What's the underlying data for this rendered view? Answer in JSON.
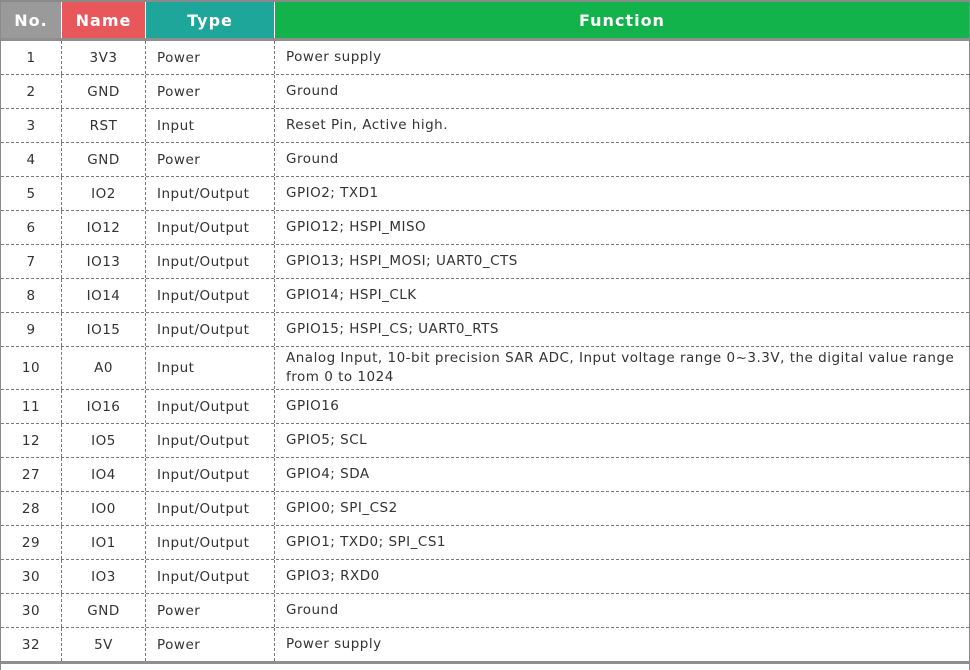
{
  "headers": [
    {
      "label": "No.",
      "color": "#9a9a9a"
    },
    {
      "label": "Name",
      "color": "#e8585a"
    },
    {
      "label": "Type",
      "color": "#1ea69a"
    },
    {
      "label": "Function",
      "color": "#12b34a"
    }
  ],
  "rows": [
    {
      "no": "1",
      "name": "3V3",
      "type": "Power",
      "function": "Power supply"
    },
    {
      "no": "2",
      "name": "GND",
      "type": "Power",
      "function": "Ground"
    },
    {
      "no": "3",
      "name": "RST",
      "type": "Input",
      "function": "Reset Pin, Active high."
    },
    {
      "no": "4",
      "name": "GND",
      "type": "Power",
      "function": "Ground"
    },
    {
      "no": "5",
      "name": "IO2",
      "type": "Input/Output",
      "function": "GPIO2; TXD1"
    },
    {
      "no": "6",
      "name": "IO12",
      "type": "Input/Output",
      "function": "GPIO12; HSPI_MISO"
    },
    {
      "no": "7",
      "name": "IO13",
      "type": "Input/Output",
      "function": "GPIO13; HSPI_MOSI; UART0_CTS"
    },
    {
      "no": "8",
      "name": "IO14",
      "type": "Input/Output",
      "function": "GPIO14; HSPI_CLK"
    },
    {
      "no": "9",
      "name": "IO15",
      "type": "Input/Output",
      "function": "GPIO15; HSPI_CS; UART0_RTS"
    },
    {
      "no": "10",
      "name": "A0",
      "type": "Input",
      "function": "Analog Input, 10-bit precision SAR ADC, Input voltage range 0~3.3V, the digital value range from 0 to 1024"
    },
    {
      "no": "11",
      "name": "IO16",
      "type": "Input/Output",
      "function": "GPIO16"
    },
    {
      "no": "12",
      "name": "IO5",
      "type": "Input/Output",
      "function": "GPIO5; SCL"
    },
    {
      "no": "27",
      "name": "IO4",
      "type": "Input/Output",
      "function": "GPIO4; SDA"
    },
    {
      "no": "28",
      "name": "IO0",
      "type": "Input/Output",
      "function": "GPIO0; SPI_CS2"
    },
    {
      "no": "29",
      "name": "IO1",
      "type": "Input/Output",
      "function": "GPIO1; TXD0; SPI_CS1"
    },
    {
      "no": "30",
      "name": "IO3",
      "type": "Input/Output",
      "function": "GPIO3; RXD0"
    },
    {
      "no": "30",
      "name": "GND",
      "type": "Power",
      "function": "Ground"
    },
    {
      "no": "32",
      "name": "5V",
      "type": "Power",
      "function": "Power supply"
    }
  ]
}
